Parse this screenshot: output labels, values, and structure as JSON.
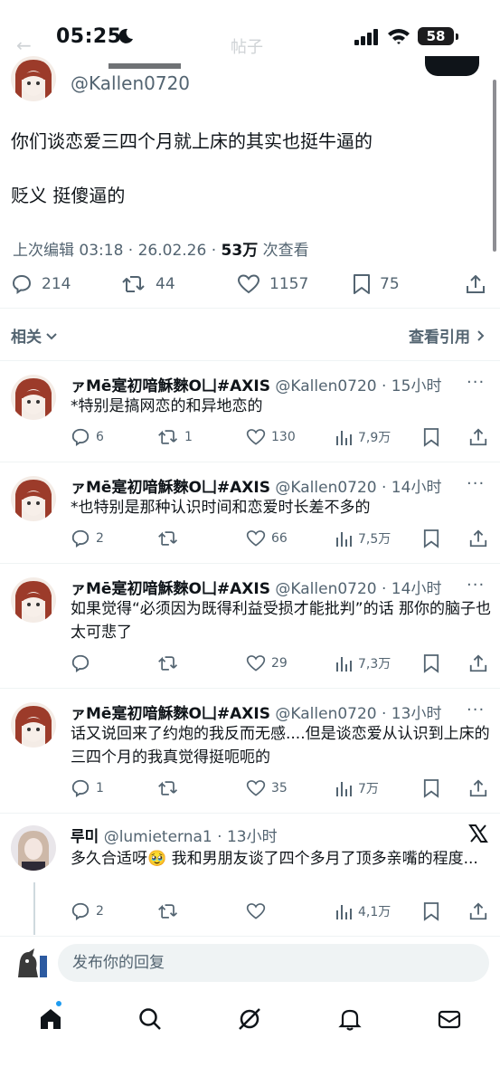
{
  "status_bar": {
    "time": "05:25",
    "battery": "58"
  },
  "ghost_header": {
    "title": "帖子"
  },
  "main_tweet": {
    "handle": "@Kallen0720",
    "text_line1": "你们谈恋爱三四个月就上床的其实也挺牛逼的",
    "text_line2": "贬义 挺傻逼的",
    "edited_time": "上次编辑 03:18 · 26.02.26 · ",
    "views_count": "53万",
    "views_label": " 次查看",
    "replies": "214",
    "reposts": "44",
    "likes": "1157",
    "bookmarks": "75"
  },
  "filter": {
    "related_label": "相关",
    "quotes_label": "查看引用"
  },
  "replies": [
    {
      "name": "ァMē寔初喑穌麳O凵#AXIS",
      "handle": "@Kallen0720 · 15小时",
      "more": "···",
      "text": "*特别是搞网恋的和异地恋的",
      "comments": "6",
      "reposts": "1",
      "likes": "130",
      "views": "7,9万"
    },
    {
      "name": "ァMē寔初喑穌麳O凵#AXIS",
      "handle": "@Kallen0720 · 14小时",
      "more": "···",
      "text": "*也特别是那种认识时间和恋爱时长差不多的",
      "comments": "2",
      "reposts": "",
      "likes": "66",
      "views": "7,5万"
    },
    {
      "name": "ァMē寔初喑穌麳O凵#AXIS",
      "handle": "@Kallen0720 · 14小时",
      "more": "···",
      "text": "如果觉得“必须因为既得利益受损才能批判”的话 那你的脑子也太可悲了",
      "comments": "",
      "reposts": "",
      "likes": "29",
      "views": "7,3万"
    },
    {
      "name": "ァMē寔初喑穌麳O凵#AXIS",
      "handle": "@Kallen0720 · 13小时",
      "more": "···",
      "text": "话又说回来了约炮的我反而无感....但是谈恋爱从认识到上床的三四个月的我真觉得挺呃呃的",
      "comments": "1",
      "reposts": "",
      "likes": "35",
      "views": "7万"
    },
    {
      "name": "루미",
      "handle": "@lumieterna1 · 13小时",
      "more": "",
      "text": "多久合适呀🥹 我和男朋友谈了四个多月了顶多亲嘴的程度...",
      "comments": "2",
      "reposts": "",
      "likes": "",
      "views": "4,1万"
    }
  ],
  "compose": {
    "placeholder": "发布你的回复"
  },
  "colors": {
    "text": "#0f1419",
    "secondary": "#536471",
    "accent": "#1d9bf0",
    "divider": "#eff3f4"
  }
}
